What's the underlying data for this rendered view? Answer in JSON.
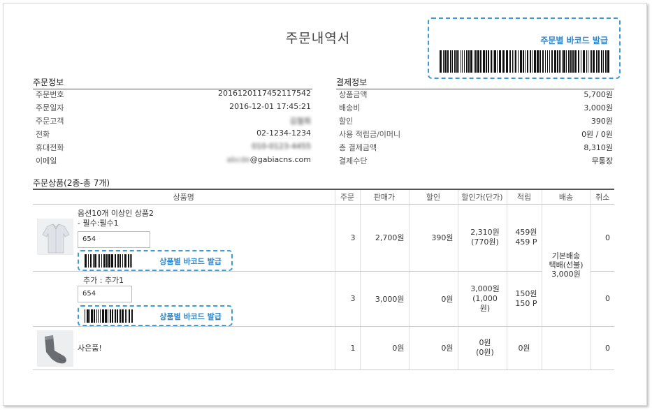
{
  "page_title": "주문내역서",
  "order_barcode": {
    "label": "주문별 바코드 발급",
    "icon": "barcode-icon",
    "accent": "#3c9cd6"
  },
  "order_info": {
    "title": "주문정보",
    "rows": [
      {
        "label": "주문번호",
        "value": "2016120117452117542"
      },
      {
        "label": "주문일자",
        "value": "2016-12-01 17:45:21"
      },
      {
        "label": "주문고객",
        "value": "김철희"
      },
      {
        "label": "전화",
        "value": "02-1234-1234"
      },
      {
        "label": "휴대전화",
        "value": "010-0123-4455"
      },
      {
        "label": "이메일",
        "value_prefix": "abcde",
        "value": "@gabiacns.com"
      }
    ]
  },
  "payment_info": {
    "title": "결제정보",
    "rows": [
      {
        "label": "상품금액",
        "value": "5,700원"
      },
      {
        "label": "배송비",
        "value": "3,000원"
      },
      {
        "label": "할인",
        "value": "390원"
      },
      {
        "label": "사용 적립금/이머니",
        "value": "0원 / 0원"
      },
      {
        "label": "총 결제금액",
        "value": "8,310원"
      },
      {
        "label": "결제수단",
        "value": "무통장"
      }
    ]
  },
  "products": {
    "title": "주문상품(2종-총 7개)",
    "headers": [
      "상품명",
      "주문",
      "판매가",
      "할인",
      "할인가(단가)",
      "적립",
      "배송",
      "취소"
    ],
    "shipping": {
      "line1": "기본배송",
      "line2": "택배(선불)",
      "line3": "3,000원"
    },
    "barcode_label": "상품별 바코드 발급",
    "rows": [
      {
        "name": "옵션10개 이상인 상품2",
        "option": "- 필수:필수1",
        "qty_input": "654",
        "qty": "3",
        "price": "2,700원",
        "discount": "390원",
        "unit_price": "2,310원",
        "unit_discount": "(770원)",
        "point1": "459원",
        "point2": "459 P",
        "cancel": "0"
      },
      {
        "option": "추가 : 추가1",
        "qty_input": "654",
        "qty": "3",
        "price": "3,000원",
        "discount": "0원",
        "unit_price": "3,000원",
        "unit_discount": "(1,000원)",
        "point1": "150원",
        "point2": "150 P",
        "cancel": "0"
      },
      {
        "name": "사은품!",
        "qty": "1",
        "price": "0원",
        "discount": "0원",
        "unit_price": "0원",
        "unit_discount": "(0원)",
        "point1": "0원",
        "cancel": "0"
      }
    ]
  }
}
